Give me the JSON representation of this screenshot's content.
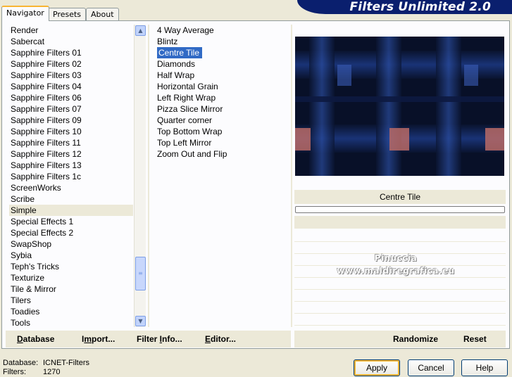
{
  "app_title": "Filters Unlimited 2.0",
  "tabs": [
    {
      "label": "Navigator",
      "active": true
    },
    {
      "label": "Presets",
      "active": false
    },
    {
      "label": "About",
      "active": false
    }
  ],
  "categories": [
    "Render",
    "Sabercat",
    "Sapphire Filters 01",
    "Sapphire Filters 02",
    "Sapphire Filters 03",
    "Sapphire Filters 04",
    "Sapphire Filters 06",
    "Sapphire Filters 07",
    "Sapphire Filters 09",
    "Sapphire Filters 10",
    "Sapphire Filters 11",
    "Sapphire Filters 12",
    "Sapphire Filters 13",
    "Sapphire Filters 1c",
    "ScreenWorks",
    "Scribe",
    "Simple",
    "Special Effects 1",
    "Special Effects 2",
    "SwapShop",
    "Sybia",
    "Teph's Tricks",
    "Texturize",
    "Tile & Mirror",
    "Tilers",
    "Toadies",
    "Tools"
  ],
  "selected_category": "Simple",
  "filters": [
    "4 Way Average",
    "Blintz",
    "Centre Tile",
    "Diamonds",
    "Half Wrap",
    "Horizontal Grain",
    "Left Right Wrap",
    "Pizza Slice Mirror",
    "Quarter corner",
    "Top Bottom Wrap",
    "Top Left Mirror",
    "Zoom Out and Flip"
  ],
  "selected_filter": "Centre Tile",
  "preview_filter_name": "Centre Tile",
  "watermark": {
    "line1": "Pinuccia",
    "line2": "www.maldiregrafica.eu"
  },
  "toolbar_left": {
    "database": {
      "u": "D",
      "rest": "atabase"
    },
    "import": {
      "pre": "I",
      "u": "m",
      "rest": "port..."
    },
    "filter_info": {
      "pre": "Filter ",
      "u": "I",
      "rest": "nfo..."
    },
    "editor": {
      "u": "E",
      "rest": "ditor..."
    }
  },
  "toolbar_right": {
    "randomize": "Randomize",
    "reset": "Reset"
  },
  "status": {
    "database_label": "Database:",
    "database_value": "ICNET-Filters",
    "filters_label": "Filters:",
    "filters_value": "1270"
  },
  "buttons": {
    "apply": "Apply",
    "cancel": "Cancel",
    "help": "Help"
  },
  "colors": {
    "title_bg": "#0a1f6e",
    "selection": "#316ac5",
    "focus": "#f8b432"
  }
}
